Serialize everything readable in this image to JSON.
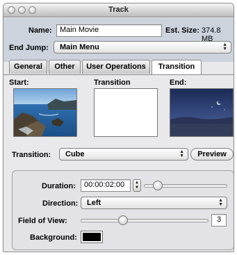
{
  "window": {
    "title": "Track"
  },
  "header": {
    "name_label": "Name:",
    "name_value": "Main Movie",
    "est_size_label": "Est. Size:",
    "est_size_value": "374.8 MB",
    "end_jump_label": "End Jump:",
    "end_jump_value": "Main Menu"
  },
  "tabs": [
    {
      "label": "General"
    },
    {
      "label": "Other"
    },
    {
      "label": "User Operations"
    },
    {
      "label": "Transition",
      "active": true
    }
  ],
  "preview": {
    "start_label": "Start:",
    "transition_label": "Transition",
    "end_label": "End:"
  },
  "transition": {
    "label": "Transition:",
    "value": "Cube",
    "preview_button": "Preview"
  },
  "settings": {
    "duration_label": "Duration:",
    "duration_value": "00:00:02:00",
    "duration_slider": 0.12,
    "direction_label": "Direction:",
    "direction_value": "Left",
    "fov_label": "Field of View:",
    "fov_value": "3",
    "fov_slider": 0.32,
    "background_label": "Background:",
    "background_color": "#000000"
  },
  "colors": {
    "header_bg": "#ccd3dd",
    "pane_bg": "#e9e9ec"
  }
}
